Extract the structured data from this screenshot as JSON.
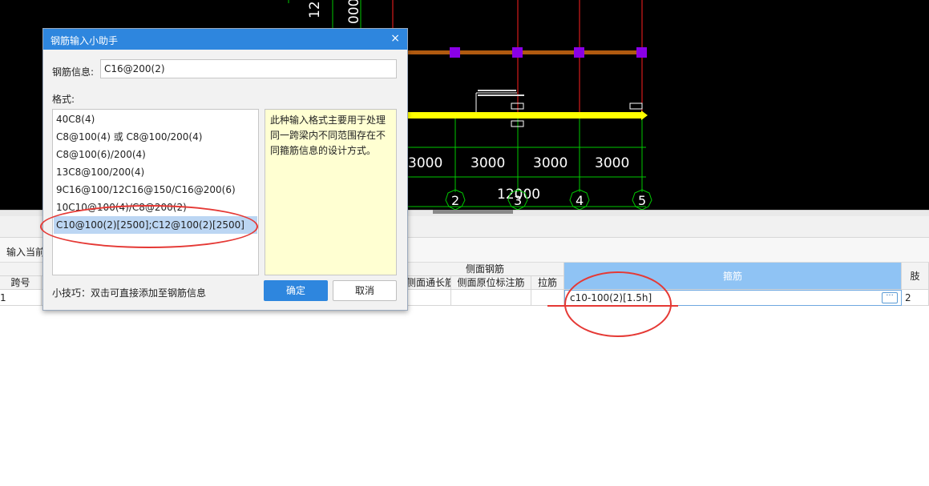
{
  "cad": {
    "dim_top_vertical_a": "12",
    "dim_top_vertical_b": "000",
    "span_labels": [
      "3000",
      "3000",
      "3000",
      "3000"
    ],
    "total_dim": "12000",
    "axis_labels": [
      "2",
      "3",
      "4",
      "5"
    ],
    "colors": {
      "background": "#000000",
      "gridline": "#00c800",
      "column": "#ff2020",
      "beam": "#b05a10",
      "node": "#8a00e6",
      "rebar": "#ffff00"
    }
  },
  "toolbar": {
    "input_label": "输入当前"
  },
  "table": {
    "group_header_side": "侧面钢筋",
    "header_span": "跨号",
    "header_side_through": "侧面通长筋",
    "header_side_original": "侧面原位标注筋",
    "header_tie": "拉筋",
    "header_stirrup": "箍筋",
    "header_right_partial": "肢",
    "row": {
      "span_no": "1",
      "stirrup_value": "c10-100(2)[1.5h]",
      "right_value": "2"
    },
    "more_button": "···"
  },
  "dialog": {
    "title": "钢筋输入小助手",
    "close": "×",
    "rebar_info_label": "钢筋信息:",
    "rebar_info_value": "C16@200(2)",
    "format_label": "格式:",
    "formats": [
      "40C8(4)",
      "C8@100(4) 或 C8@100/200(4)",
      "C8@100(6)/200(4)",
      "13C8@100/200(4)",
      "9C16@100/12C16@150/C16@200(6)",
      "10C10@100(4)/C8@200(2)",
      "C10@100(2)[2500];C12@100(2)[2500]"
    ],
    "selected_index": 6,
    "description": "此种输入格式主要用于处理同一跨梁内不同范围存在不同箍筋信息的设计方式。",
    "tip": "小技巧：双击可直接添加至钢筋信息",
    "ok_label": "确定",
    "cancel_label": "取消",
    "colors": {
      "title_bar": "#2e86de",
      "selected_item": "#bcd6f3",
      "description_bg": "#ffffd2"
    }
  }
}
